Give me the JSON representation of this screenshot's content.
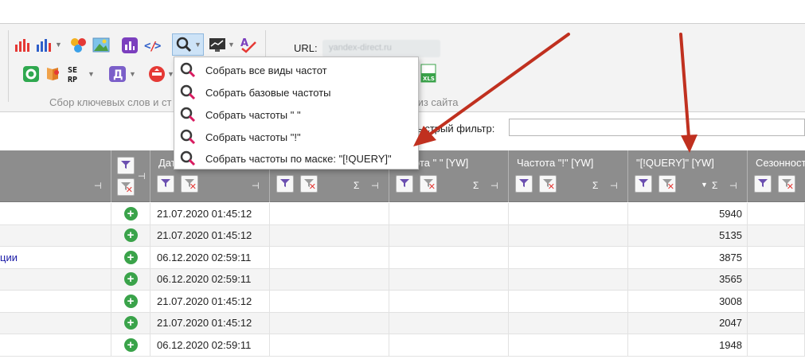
{
  "ribbon": {
    "url_label": "URL:",
    "url_value": "yandex-direct.ru",
    "group_label_left": "Сбор ключевых слов и ст",
    "group_label_right": "лиз сайта",
    "icons_row1": [
      "bar-chart-red-icon",
      "bar-chart-blue-icon",
      "colored-dots-icon",
      "picture-icon",
      "wordstat-icon",
      "code-tag-icon",
      "search-magnifier-icon",
      "monitor-chart-icon",
      "spellcheck-icon"
    ],
    "icons_row2": [
      "green-ring-icon",
      "pin-icon",
      "serp-icon",
      "direct-d-icon",
      "stop-icon",
      "xls-icon"
    ],
    "serp_text": "SE RP",
    "d_text": "Д",
    "xls_text": "XLS"
  },
  "filter": {
    "label": "ыстрый фильтр:",
    "value": ""
  },
  "dropdown": {
    "items": [
      "Собрать все виды частот",
      "Собрать базовые частоты",
      "Собрать частоты \" \"",
      "Собрать частоты \"!\"",
      "Собрать частоты по маске: \"[!QUERY]\""
    ]
  },
  "grid": {
    "headers": {
      "date": "Дат",
      "freq_quotes": "ота \" \" [YW]",
      "freq_excl": "Частота \"!\" [YW]",
      "freq_mask": "\"[!QUERY]\" [YW]",
      "season": "Сезонност"
    },
    "sum_symbol": "Σ",
    "sort_symbol": "▼",
    "pin_symbol": "⊣",
    "rows": [
      {
        "link": "",
        "date": "21.07.2020 01:45:12",
        "value": "5940"
      },
      {
        "link": "",
        "date": "21.07.2020 01:45:12",
        "value": "5135"
      },
      {
        "link": "ции",
        "date": "06.12.2020 02:59:11",
        "value": "3875"
      },
      {
        "link": "",
        "date": "06.12.2020 02:59:11",
        "value": "3565"
      },
      {
        "link": "",
        "date": "21.07.2020 01:45:12",
        "value": "3008"
      },
      {
        "link": "",
        "date": "21.07.2020 01:45:12",
        "value": "2047"
      },
      {
        "link": "",
        "date": "06.12.2020 02:59:11",
        "value": "1948"
      }
    ]
  },
  "colors": {
    "accent_red": "#c0301f",
    "add_green": "#3aa34a",
    "header_gray": "#8d8d8d",
    "link_blue": "#1a1aa6"
  }
}
